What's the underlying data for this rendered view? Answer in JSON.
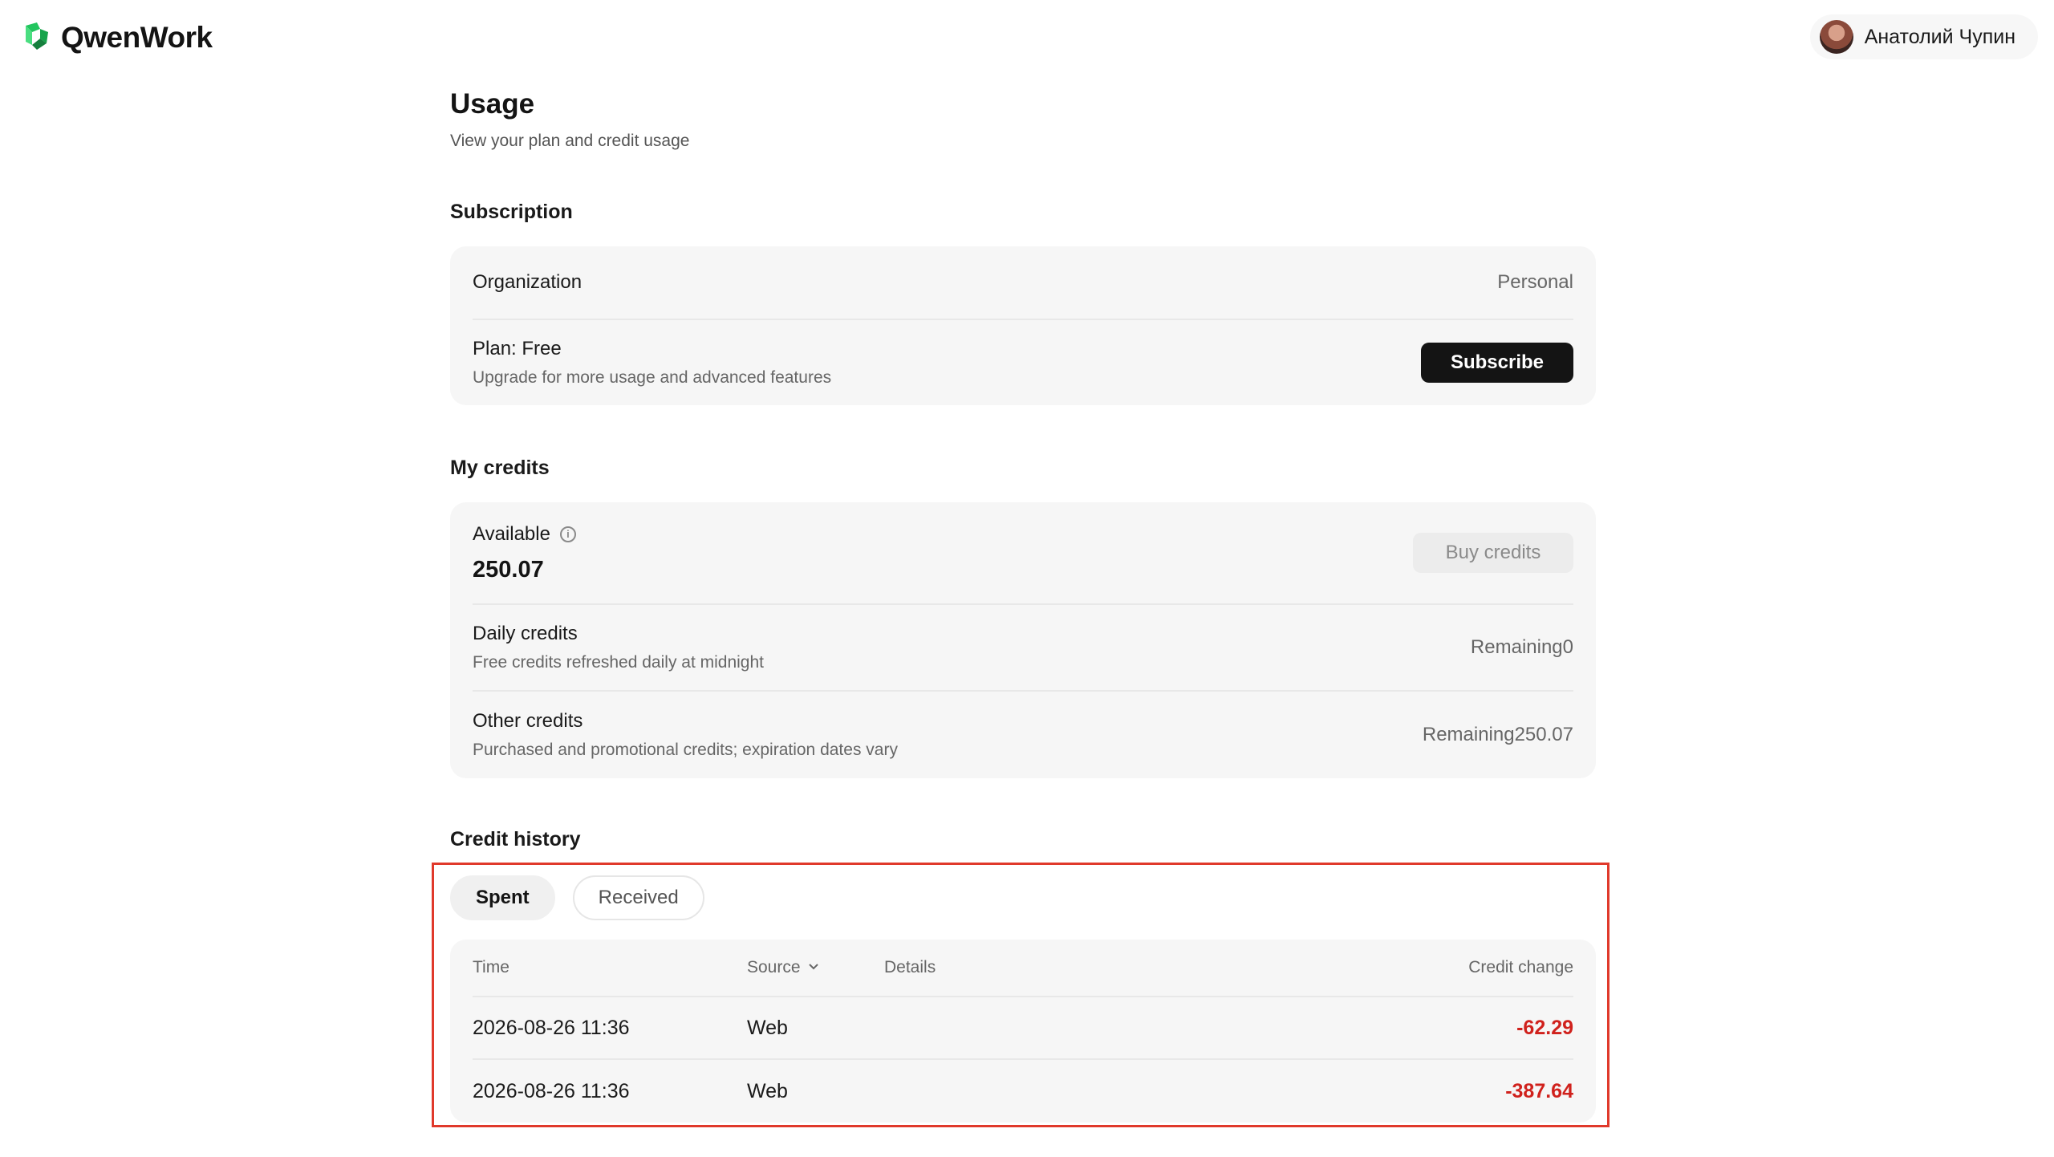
{
  "header": {
    "app_name": "QwenWork",
    "user_name": "Анатолий Чупин"
  },
  "page": {
    "title": "Usage",
    "subtitle": "View your plan and credit usage"
  },
  "subscription": {
    "section_title": "Subscription",
    "organization_label": "Organization",
    "organization_value": "Personal",
    "plan_label": "Plan: Free",
    "plan_sub": "Upgrade for more usage and advanced features",
    "subscribe_label": "Subscribe"
  },
  "credits": {
    "section_title": "My credits",
    "available_label": "Available",
    "available_value": "250.07",
    "buy_label": "Buy credits",
    "daily_label": "Daily credits",
    "daily_sub": "Free credits refreshed daily at midnight",
    "daily_remaining": "Remaining0",
    "other_label": "Other credits",
    "other_sub": "Purchased and promotional credits; expiration dates vary",
    "other_remaining": "Remaining250.07"
  },
  "history": {
    "section_title": "Credit history",
    "tabs": [
      {
        "label": "Spent",
        "active": true
      },
      {
        "label": "Received",
        "active": false
      }
    ],
    "columns": {
      "time": "Time",
      "source": "Source",
      "details": "Details",
      "change": "Credit change"
    },
    "rows": [
      {
        "time": "2026-08-26 11:36",
        "source": "Web",
        "details": "",
        "change": "-62.29"
      },
      {
        "time": "2026-08-26 11:36",
        "source": "Web",
        "details": "",
        "change": "-387.64"
      }
    ]
  },
  "colors": {
    "highlight_frame": "#e0392b",
    "negative": "#d0211c",
    "logo_green": "#22c55e"
  }
}
